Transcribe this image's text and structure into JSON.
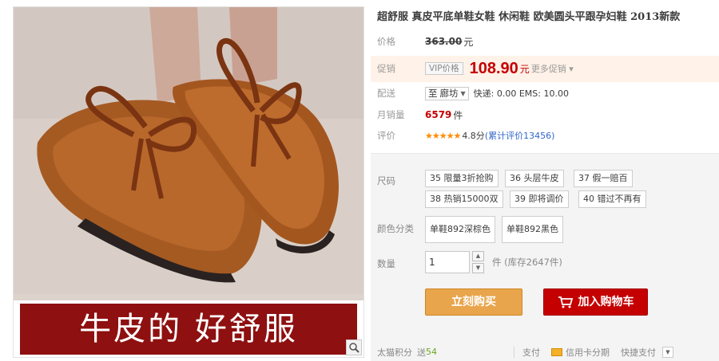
{
  "product": {
    "title": "超舒服 真皮平底单鞋女鞋 休闲鞋 欧美圆头平跟孕妇鞋 2013新款",
    "banner_text": "牛皮的 好舒服"
  },
  "info": {
    "price_label": "价格",
    "original_price": "363.00",
    "yuan": "元",
    "promo_label": "促销",
    "vip_tag": "VIP价格",
    "promo_price": "108.90",
    "promo_yuan": "元",
    "more_promos": "更多促销",
    "shipping_label": "配送",
    "destination_prefix": "至",
    "destination": "廊坊",
    "shipping_fees": "快递: 0.00 EMS: 10.00",
    "monthly_sales_label": "月销量",
    "monthly_sales": "6579",
    "sales_unit": "件",
    "rating_label": "评价",
    "rating_stars": "★★★★★",
    "rating_score": "4.8分",
    "review_count": "(累计评价13456)"
  },
  "sku": {
    "size_label": "尺码",
    "sizes": [
      "35 限量3折抢购",
      "36 头层牛皮",
      "37 假一赔百",
      "38 热销15000双",
      "39 即将调价",
      "40 错过不再有"
    ],
    "color_label": "颜色分类",
    "colors": [
      "单鞋892深棕色",
      "单鞋892黑色"
    ],
    "quantity_label": "数量",
    "quantity_value": "1",
    "stock": "件 (库存2647件)",
    "buy_now": "立刻购买",
    "add_to_cart": "加入购物车"
  },
  "footer": {
    "points_label": "太猫积分",
    "points_prefix": "送",
    "points_value": "54",
    "payment_label": "支付",
    "credit_installment": "信用卡分期",
    "quick_pay": "快捷支付"
  },
  "colors": {
    "accent_red": "#c40000",
    "buy_button": "#e9a54c",
    "banner": "#8e1010",
    "promo_band": "#fff2e8"
  }
}
